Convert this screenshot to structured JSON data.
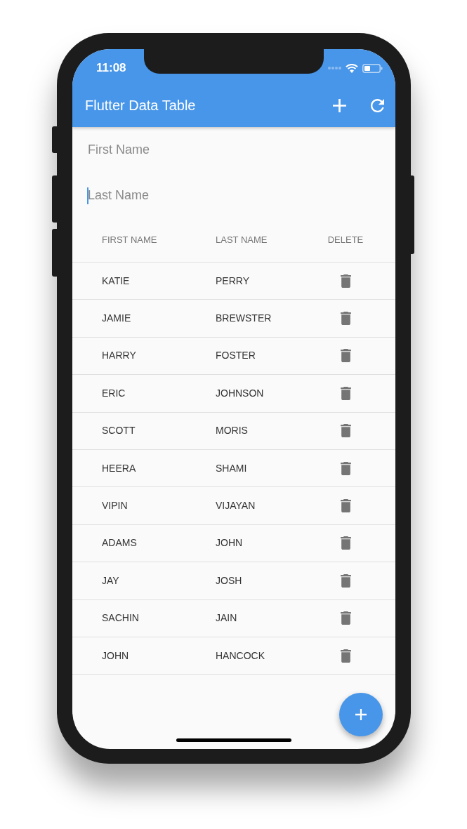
{
  "status_bar": {
    "time": "11:08"
  },
  "app_bar": {
    "title": "Flutter Data Table"
  },
  "form": {
    "fields": [
      {
        "placeholder": "First Name",
        "focused": false
      },
      {
        "placeholder": "Last Name",
        "focused": true
      }
    ]
  },
  "table": {
    "columns": [
      "FIRST NAME",
      "LAST NAME",
      "DELETE"
    ],
    "rows": [
      {
        "first_name": "KATIE",
        "last_name": "PERRY"
      },
      {
        "first_name": "JAMIE",
        "last_name": "BREWSTER"
      },
      {
        "first_name": "HARRY",
        "last_name": "FOSTER"
      },
      {
        "first_name": "ERIC",
        "last_name": "JOHNSON"
      },
      {
        "first_name": "SCOTT",
        "last_name": "MORIS"
      },
      {
        "first_name": "HEERA",
        "last_name": "SHAMI"
      },
      {
        "first_name": "VIPIN",
        "last_name": "VIJAYAN"
      },
      {
        "first_name": "ADAMS",
        "last_name": "JOHN"
      },
      {
        "first_name": "JAY",
        "last_name": "JOSH"
      },
      {
        "first_name": "SACHIN",
        "last_name": "JAIN"
      },
      {
        "first_name": "JOHN",
        "last_name": "HANCOCK"
      }
    ]
  }
}
